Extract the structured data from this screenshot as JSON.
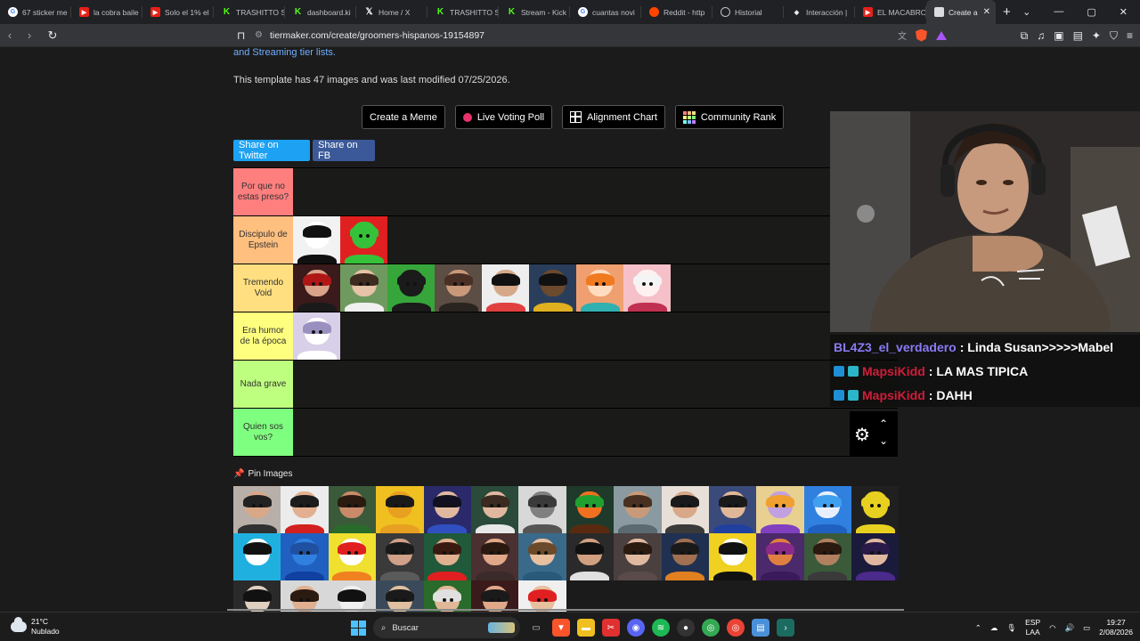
{
  "browser": {
    "tabs": [
      {
        "title": "67 sticker me",
        "icon": "google-icon",
        "fav": "g"
      },
      {
        "title": "la cobra baile",
        "icon": "youtube-icon",
        "fav": "yt"
      },
      {
        "title": "Solo el 1% el",
        "icon": "youtube-icon",
        "fav": "yt"
      },
      {
        "title": "TRASHITTO S",
        "icon": "kick-icon",
        "fav": "kick"
      },
      {
        "title": "dashboard.ki",
        "icon": "kick-icon",
        "fav": "kick"
      },
      {
        "title": "Home / X",
        "icon": "x-icon",
        "fav": "x"
      },
      {
        "title": "TRASHITTO S",
        "icon": "kick-icon",
        "fav": "kick"
      },
      {
        "title": "Stream - Kick",
        "icon": "kick-icon",
        "fav": "kick"
      },
      {
        "title": "cuantas novi",
        "icon": "google-icon",
        "fav": "g"
      },
      {
        "title": "Reddit - http",
        "icon": "reddit-icon",
        "fav": "rd"
      },
      {
        "title": "Historial",
        "icon": "history-icon",
        "fav": "hist"
      },
      {
        "title": "Interacción |",
        "icon": "diamond-icon",
        "fav": "dm"
      },
      {
        "title": "EL MACABRO",
        "icon": "youtube-icon",
        "fav": "yt"
      },
      {
        "title": "Create a",
        "icon": "document-icon",
        "fav": "doc",
        "active": true
      }
    ],
    "url": "tiermaker.com/create/groomers-hispanos-19154897"
  },
  "page": {
    "intro_link": "and Streaming tier lists.",
    "template_info": "This template has 47 images and was last modified 07/25/2026.",
    "buttons": {
      "meme": "Create a Meme",
      "live": "Live Voting Poll",
      "alignment": "Alignment Chart",
      "community": "Community Rank"
    },
    "share": {
      "twitter": "Share on Twitter",
      "fb": "Share on FB"
    },
    "tiers": [
      {
        "label": "Por que no estas preso?",
        "color": "#ff7f7f",
        "items": []
      },
      {
        "label": "Discipulo de Epstein",
        "color": "#ffbf7f",
        "items": [
          {
            "bg": "#f2f2f2",
            "skin": "#ffffff",
            "hair": "#111111",
            "shirt": "#111111"
          },
          {
            "bg": "#e02020",
            "skin": "#35c23a",
            "hair": "#35c23a",
            "shirt": "#35c23a"
          }
        ]
      },
      {
        "label": "Tremendo Void",
        "color": "#ffdf7f",
        "items": [
          {
            "bg": "#3a1a1a",
            "skin": "#d9a38a",
            "hair": "#b01616",
            "shirt": "#1a1a1a"
          },
          {
            "bg": "#6f9a5f",
            "skin": "#e6c2a6",
            "hair": "#3d2b1f",
            "shirt": "#f0f0f0"
          },
          {
            "bg": "#36a63a",
            "skin": "#1b1b1b",
            "hair": "#1b1b1b",
            "shirt": "#1b1b1b"
          },
          {
            "bg": "#5c4d45",
            "skin": "#c89878",
            "hair": "#4a3024",
            "shirt": "#2a2420"
          },
          {
            "bg": "#eeeeee",
            "skin": "#d6a88a",
            "hair": "#111111",
            "shirt": "#e04040"
          },
          {
            "bg": "#2a3e5c",
            "skin": "#6b4a2e",
            "hair": "#111111",
            "shirt": "#e0b020"
          },
          {
            "bg": "#f0a070",
            "skin": "#ffdcc0",
            "hair": "#f07a20",
            "shirt": "#30b0b0"
          },
          {
            "bg": "#f6c0c8",
            "skin": "#fff1f1",
            "hair": "#f4f4f4",
            "shirt": "#c03050"
          }
        ]
      },
      {
        "label": "Era humor de la época",
        "color": "#ffff7f",
        "items": [
          {
            "bg": "#d8d0e8",
            "skin": "#ffffff",
            "hair": "#9a90c0",
            "shirt": "#ffffff"
          }
        ]
      },
      {
        "label": "Nada grave",
        "color": "#bfff7f",
        "items": []
      },
      {
        "label": "Quien sos vos?",
        "color": "#7fff7f",
        "items": []
      }
    ],
    "pin_label": "Pin Images",
    "pool": [
      {
        "bg": "#b8b0a8",
        "skin": "#d8a888",
        "hair": "#222222",
        "shirt": "#303030"
      },
      {
        "bg": "#ececec",
        "skin": "#e2b090",
        "hair": "#1c1c1c",
        "shirt": "#d22020"
      },
      {
        "bg": "#3a5a3a",
        "skin": "#c88a6a",
        "hair": "#2a1a10",
        "shirt": "#2a6a2a"
      },
      {
        "bg": "#f0c020",
        "skin": "#e8a020",
        "hair": "#1a1a1a",
        "shirt": "#e8a020"
      },
      {
        "bg": "#2a2a6a",
        "skin": "#e0b8a0",
        "hair": "#101020",
        "shirt": "#3050c0"
      },
      {
        "bg": "#2a4a3a",
        "skin": "#e0b8a0",
        "hair": "#3a2a20",
        "shirt": "#e8e8e8"
      },
      {
        "bg": "#d8d8d8",
        "skin": "#808080",
        "hair": "#3a3a3a",
        "shirt": "#555555"
      },
      {
        "bg": "#1f3a2a",
        "skin": "#f07020",
        "hair": "#20a030",
        "shirt": "#5a2a10"
      },
      {
        "bg": "#8a9aa0",
        "skin": "#c89a7a",
        "hair": "#4a3020",
        "shirt": "#5a6a70"
      },
      {
        "bg": "#e8e0d8",
        "skin": "#d8a888",
        "hair": "#1a1a1a",
        "shirt": "#3a3a3a"
      },
      {
        "bg": "#3a4a7a",
        "skin": "#e0b898",
        "hair": "#1a1a1a",
        "shirt": "#2040a0"
      },
      {
        "bg": "#e8d090",
        "skin": "#c0a0e0",
        "hair": "#f0a030",
        "shirt": "#8040c0"
      },
      {
        "bg": "#3080e0",
        "skin": "#e8f0ff",
        "hair": "#40a0f0",
        "shirt": "#2060c0"
      },
      {
        "bg": "#202020",
        "skin": "#e8d020",
        "hair": "#e8d020",
        "shirt": "#e8d020"
      },
      {
        "bg": "#20b0e0",
        "skin": "#ffffff",
        "hair": "#111111",
        "shirt": "#20b0e0"
      },
      {
        "bg": "#2060c0",
        "skin": "#3080e0",
        "hair": "#2050a0",
        "shirt": "#1040a0"
      },
      {
        "bg": "#f0e030",
        "skin": "#ffffff",
        "hair": "#e02020",
        "shirt": "#f08020"
      },
      {
        "bg": "#3a3a3a",
        "skin": "#d0a088",
        "hair": "#1a1a1a",
        "shirt": "#5a5a5a"
      },
      {
        "bg": "#205a3a",
        "skin": "#e0b090",
        "hair": "#3a1a10",
        "shirt": "#e02020"
      },
      {
        "bg": "#4a3030",
        "skin": "#e0a888",
        "hair": "#2a1a10",
        "shirt": "#3a2a2a"
      },
      {
        "bg": "#3a6a8a",
        "skin": "#e8c0a0",
        "hair": "#6a4a2a",
        "shirt": "#2a5a7a"
      },
      {
        "bg": "#2a2a2a",
        "skin": "#d0a080",
        "hair": "#111111",
        "shirt": "#e0e0e0"
      },
      {
        "bg": "#4a4040",
        "skin": "#e0b8a0",
        "hair": "#2a1a10",
        "shirt": "#5a4a4a"
      },
      {
        "bg": "#203050",
        "skin": "#a07050",
        "hair": "#1a1a1a",
        "shirt": "#e08020"
      },
      {
        "bg": "#f0d020",
        "skin": "#ffffff",
        "hair": "#111111",
        "shirt": "#111111"
      },
      {
        "bg": "#4a2a6a",
        "skin": "#e08040",
        "hair": "#8a2a8a",
        "shirt": "#3a1a5a"
      },
      {
        "bg": "#3a5a3a",
        "skin": "#b08060",
        "hair": "#2a1a10",
        "shirt": "#3a3a3a"
      },
      {
        "bg": "#1a1a3a",
        "skin": "#e0b8a0",
        "hair": "#2a1a4a",
        "shirt": "#4a2a8a"
      },
      {
        "bg": "#2a2a2a",
        "skin": "#e0d0c0",
        "hair": "#111111",
        "shirt": "#dddddd"
      },
      {
        "bg": "#d8d8d8",
        "skin": "#e0b090",
        "hair": "#2a1a10",
        "shirt": "#3a6a3a"
      },
      {
        "bg": "#d8d8d8",
        "skin": "#f0f0f0",
        "hair": "#111111",
        "shirt": "#e0e0e0"
      },
      {
        "bg": "#3a4a5a",
        "skin": "#e0c0a0",
        "hair": "#1a1a1a",
        "shirt": "#3a8a3a"
      },
      {
        "bg": "#2a6a2a",
        "skin": "#e0b898",
        "hair": "#e0e0e0",
        "shirt": "#2a8a2a"
      },
      {
        "bg": "#3a1a1a",
        "skin": "#e0a888",
        "hair": "#1a1a1a",
        "shirt": "#a02020"
      },
      {
        "bg": "#f0f0f0",
        "skin": "#e8c0a0",
        "hair": "#e02020",
        "shirt": "#e02020"
      }
    ]
  },
  "stream": {
    "chat": [
      {
        "user": "BL4Z3_el_verdadero",
        "msg": ": Linda Susan>>>>>Mabel",
        "user_color": "#8a7bf5",
        "badges": false
      },
      {
        "user": "MapsiKidd",
        "msg": ": LA MAS TIPICA",
        "user_color": "#cf1d3a",
        "badges": true
      },
      {
        "user": "MapsiKidd",
        "msg": ": DAHH",
        "user_color": "#cf1d3a",
        "badges": true
      }
    ]
  },
  "taskbar": {
    "temp": "21°C",
    "weather": "Nublado",
    "search": "Buscar",
    "lang": "ESP",
    "lang_sub": "LAA",
    "time": "19:27",
    "date": "2/08/2026"
  }
}
